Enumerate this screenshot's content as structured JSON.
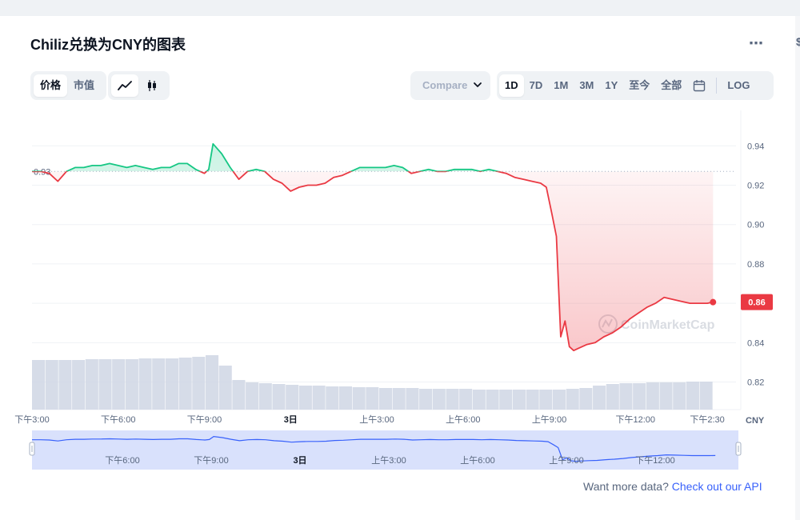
{
  "page": {
    "title": "Chiliz兑换为CNY的图表",
    "more_icon": "⋯",
    "edge_glyph": "$"
  },
  "controls": {
    "type_tabs": [
      {
        "label": "价格",
        "active": true
      },
      {
        "label": "市值",
        "active": false
      }
    ],
    "style_tabs": [
      {
        "icon": "line-chart-icon",
        "active": true
      },
      {
        "icon": "candlestick-icon",
        "active": false
      }
    ],
    "compare_label": "Compare",
    "ranges": [
      {
        "label": "1D",
        "active": true
      },
      {
        "label": "7D",
        "active": false
      },
      {
        "label": "1M",
        "active": false
      },
      {
        "label": "3M",
        "active": false
      },
      {
        "label": "1Y",
        "active": false
      },
      {
        "label": "至今",
        "active": false
      },
      {
        "label": "全部",
        "active": false
      }
    ],
    "calendar_icon": "calendar-icon",
    "log_label": "LOG"
  },
  "footer": {
    "prefix": "Want more data?",
    "link": "Check out our API"
  },
  "chart_data": {
    "type": "line",
    "watermark": "CoinMarketCap",
    "currency_label": "CNY",
    "reference_value": 0.927,
    "reference_label": "0.93",
    "last_value_label": "0.86",
    "last_value": 0.8606,
    "ylim": [
      0.806,
      0.958
    ],
    "yticks": [
      {
        "value": 0.94,
        "label": "0.94"
      },
      {
        "value": 0.92,
        "label": "0.92"
      },
      {
        "value": 0.9,
        "label": "0.90"
      },
      {
        "value": 0.88,
        "label": "0.88"
      },
      {
        "value": 0.86,
        "label": "0.86"
      },
      {
        "value": 0.84,
        "label": "0.84"
      },
      {
        "value": 0.82,
        "label": "0.82"
      }
    ],
    "xlim": [
      0,
      24.5
    ],
    "xticks": [
      {
        "value": 0,
        "label": "下午3:00"
      },
      {
        "value": 3,
        "label": "下午6:00"
      },
      {
        "value": 6,
        "label": "下午9:00"
      },
      {
        "value": 9,
        "label": "3日"
      },
      {
        "value": 12,
        "label": "上午3:00"
      },
      {
        "value": 15,
        "label": "上午6:00"
      },
      {
        "value": 18,
        "label": "上午9:00"
      },
      {
        "value": 21,
        "label": "下午12:00"
      },
      {
        "value": 23.5,
        "label": "下午2:30"
      }
    ],
    "colors": {
      "up": "#16c784",
      "down": "#ea3943",
      "navigator": "#3861fb"
    },
    "x": [
      0.0,
      0.3,
      0.6,
      0.9,
      1.2,
      1.5,
      1.8,
      2.1,
      2.4,
      2.7,
      3.0,
      3.3,
      3.6,
      3.9,
      4.2,
      4.5,
      4.8,
      5.1,
      5.4,
      5.7,
      6.0,
      6.15,
      6.3,
      6.6,
      6.9,
      7.2,
      7.5,
      7.8,
      8.1,
      8.4,
      8.7,
      9.0,
      9.3,
      9.6,
      9.9,
      10.2,
      10.5,
      10.8,
      11.1,
      11.4,
      11.7,
      12.0,
      12.3,
      12.6,
      12.9,
      13.2,
      13.5,
      13.8,
      14.1,
      14.4,
      14.7,
      15.0,
      15.3,
      15.6,
      15.9,
      16.2,
      16.5,
      16.8,
      17.1,
      17.4,
      17.7,
      17.9,
      18.1,
      18.25,
      18.4,
      18.55,
      18.7,
      18.85,
      19.0,
      19.3,
      19.6,
      19.9,
      20.2,
      20.5,
      20.8,
      21.1,
      21.4,
      21.7,
      22.0,
      22.3,
      22.6,
      22.9,
      23.2,
      23.5,
      23.7
    ],
    "values": [
      0.927,
      0.927,
      0.926,
      0.922,
      0.927,
      0.929,
      0.929,
      0.93,
      0.93,
      0.931,
      0.93,
      0.929,
      0.93,
      0.929,
      0.928,
      0.929,
      0.929,
      0.931,
      0.931,
      0.928,
      0.926,
      0.928,
      0.941,
      0.936,
      0.929,
      0.923,
      0.927,
      0.928,
      0.927,
      0.923,
      0.921,
      0.917,
      0.919,
      0.92,
      0.92,
      0.921,
      0.924,
      0.925,
      0.927,
      0.929,
      0.929,
      0.929,
      0.929,
      0.93,
      0.929,
      0.926,
      0.927,
      0.928,
      0.927,
      0.927,
      0.928,
      0.928,
      0.928,
      0.927,
      0.928,
      0.927,
      0.926,
      0.924,
      0.923,
      0.922,
      0.921,
      0.919,
      0.905,
      0.894,
      0.843,
      0.851,
      0.838,
      0.836,
      0.837,
      0.839,
      0.84,
      0.843,
      0.845,
      0.848,
      0.852,
      0.855,
      0.858,
      0.86,
      0.863,
      0.862,
      0.861,
      0.86,
      0.86,
      0.86,
      0.8606
    ],
    "volume_levels": [
      0.62,
      0.62,
      0.62,
      0.62,
      0.63,
      0.63,
      0.63,
      0.63,
      0.64,
      0.64,
      0.64,
      0.65,
      0.66,
      0.68,
      0.55,
      0.37,
      0.34,
      0.33,
      0.32,
      0.31,
      0.3,
      0.3,
      0.29,
      0.29,
      0.28,
      0.28,
      0.27,
      0.27,
      0.27,
      0.26,
      0.26,
      0.26,
      0.26,
      0.25,
      0.25,
      0.25,
      0.25,
      0.25,
      0.25,
      0.25,
      0.26,
      0.27,
      0.3,
      0.32,
      0.33,
      0.33,
      0.34,
      0.34,
      0.34,
      0.35,
      0.35
    ]
  }
}
